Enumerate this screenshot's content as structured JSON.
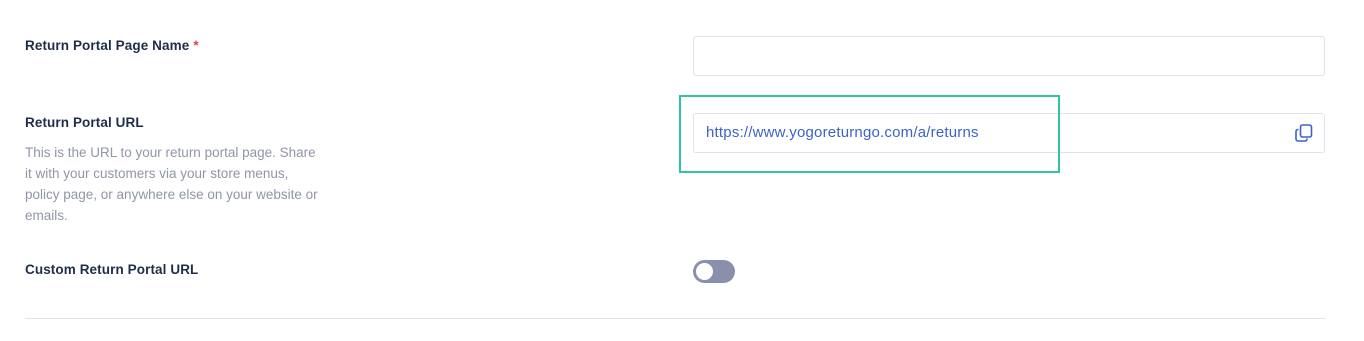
{
  "fields": {
    "page_name": {
      "label": "Return Portal Page Name",
      "required_marker": "*",
      "value": ""
    },
    "portal_url": {
      "label": "Return Portal URL",
      "help_text": "This is the URL to your return portal page. Share it with your customers via your store menus, policy page, or anywhere else on your website or emails.",
      "value": "https://www.yogoreturngo.com/a/returns",
      "copy_icon": "copy-icon"
    },
    "custom_url": {
      "label": "Custom Return Portal URL",
      "enabled": false
    }
  },
  "colors": {
    "highlight": "#2ec4a5",
    "link": "#3d63c9",
    "required": "#e0454b",
    "toggle_off": "#8c8fab"
  }
}
